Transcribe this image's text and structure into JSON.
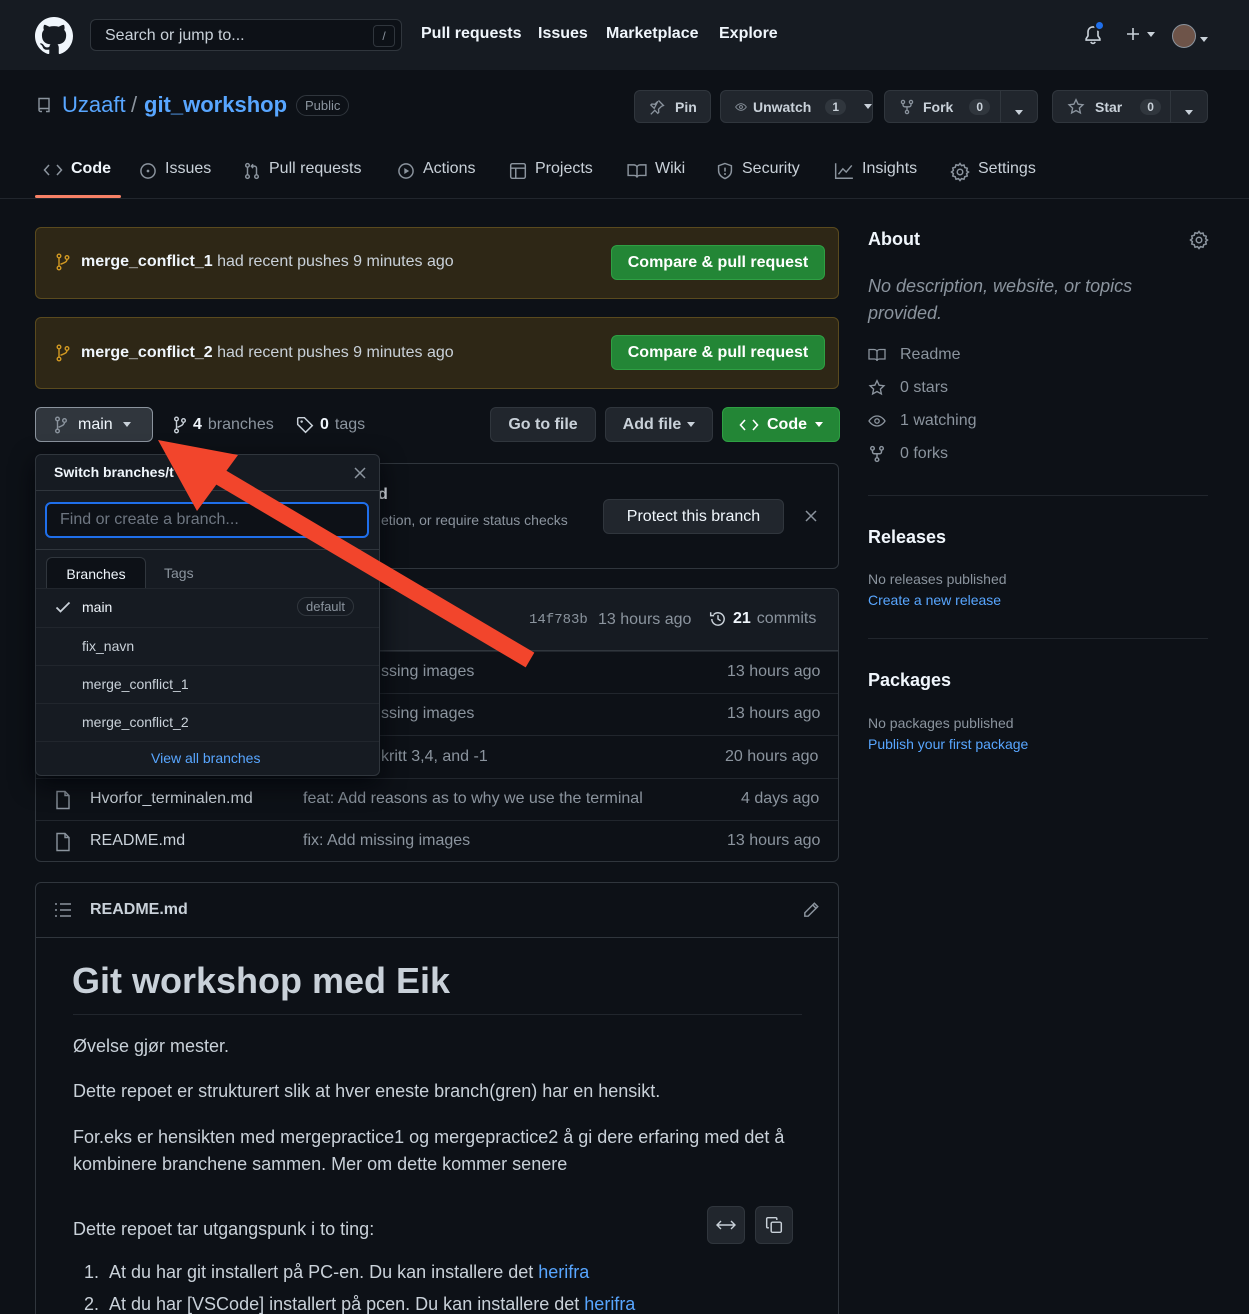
{
  "header": {
    "search_placeholder": "Search or jump to...",
    "search_hotkey": "/",
    "nav": [
      "Pull requests",
      "Issues",
      "Marketplace",
      "Explore"
    ]
  },
  "repo": {
    "owner": "Uzaaft",
    "separator": "/",
    "name": "git_workshop",
    "visibility": "Public",
    "pin_label": "Pin",
    "unwatch_label": "Unwatch",
    "watch_count": "1",
    "fork_label": "Fork",
    "fork_count": "0",
    "star_label": "Star",
    "star_count": "0"
  },
  "tabs": [
    "Code",
    "Issues",
    "Pull requests",
    "Actions",
    "Projects",
    "Wiki",
    "Security",
    "Insights",
    "Settings"
  ],
  "banners": [
    {
      "branch": "merge_conflict_1",
      "text": "had recent pushes 9 minutes ago",
      "button": "Compare & pull request"
    },
    {
      "branch": "merge_conflict_2",
      "text": "had recent pushes 9 minutes ago",
      "button": "Compare & pull request"
    }
  ],
  "branch_bar": {
    "current_branch": "main",
    "branches_count": "4",
    "branches_label": "branches",
    "tags_count": "0",
    "tags_label": "tags",
    "go_to_file": "Go to file",
    "add_file": "Add file",
    "code": "Code"
  },
  "protect": {
    "title_fragment": "d",
    "text_fragment": "etion, or require status checks",
    "button": "Protect this branch"
  },
  "commit_bar": {
    "sha": "14f783b",
    "time": "13 hours ago",
    "commits_count": "21",
    "commits_label": "commits"
  },
  "files": [
    {
      "name": "",
      "message": "ssing images",
      "time": "13 hours ago"
    },
    {
      "name": "",
      "message": "ssing images",
      "time": "13 hours ago"
    },
    {
      "name": "",
      "message": "kritt 3,4, and -1",
      "time": "20 hours ago"
    },
    {
      "name": "Hvorfor_terminalen.md",
      "message": "feat: Add reasons as to why we use the terminal",
      "time": "4 days ago"
    },
    {
      "name": "README.md",
      "message": "fix: Add missing images",
      "time": "13 hours ago"
    }
  ],
  "dropdown": {
    "title": "Switch branches/t",
    "placeholder": "Find or create a branch...",
    "tab_branches": "Branches",
    "tab_tags": "Tags",
    "default_label": "default",
    "branches": [
      "main",
      "fix_navn",
      "merge_conflict_1",
      "merge_conflict_2"
    ],
    "view_all": "View all branches"
  },
  "readme": {
    "file_name": "README.md",
    "heading": "Git workshop med Eik",
    "p1": "Øvelse gjør mester.",
    "p2": "Dette repoet er strukturert slik at hver eneste branch(gren) har en hensikt.",
    "p3": "For.eks er hensikten med mergepractice1 og mergepractice2 å gi dere erfaring med det å kombinere branchene sammen. Mer om dette kommer senere",
    "p4": "Dette repoet tar utgangspunk i to ting:",
    "li1_num": "1.",
    "li1_text": "At du har git installert på PC-en. Du kan installere det",
    "li1_link": "herifra",
    "li2_num": "2.",
    "li2_text": "At du har [VSCode] installert på pcen. Du kan installere det",
    "li2_link": "herifra"
  },
  "sidebar": {
    "about_title": "About",
    "about_desc": "No description, website, or topics provided.",
    "readme": "Readme",
    "stars": "0 stars",
    "watching": "1 watching",
    "forks": "0 forks",
    "releases_title": "Releases",
    "releases_text": "No releases published",
    "releases_link": "Create a new release",
    "packages_title": "Packages",
    "packages_text": "No packages published",
    "packages_link": "Publish your first package"
  },
  "colors": {
    "accent_link": "#58a6ff",
    "green_button": "#238636",
    "annotation_arrow": "#f2452c",
    "tab_underline": "#f78166"
  }
}
